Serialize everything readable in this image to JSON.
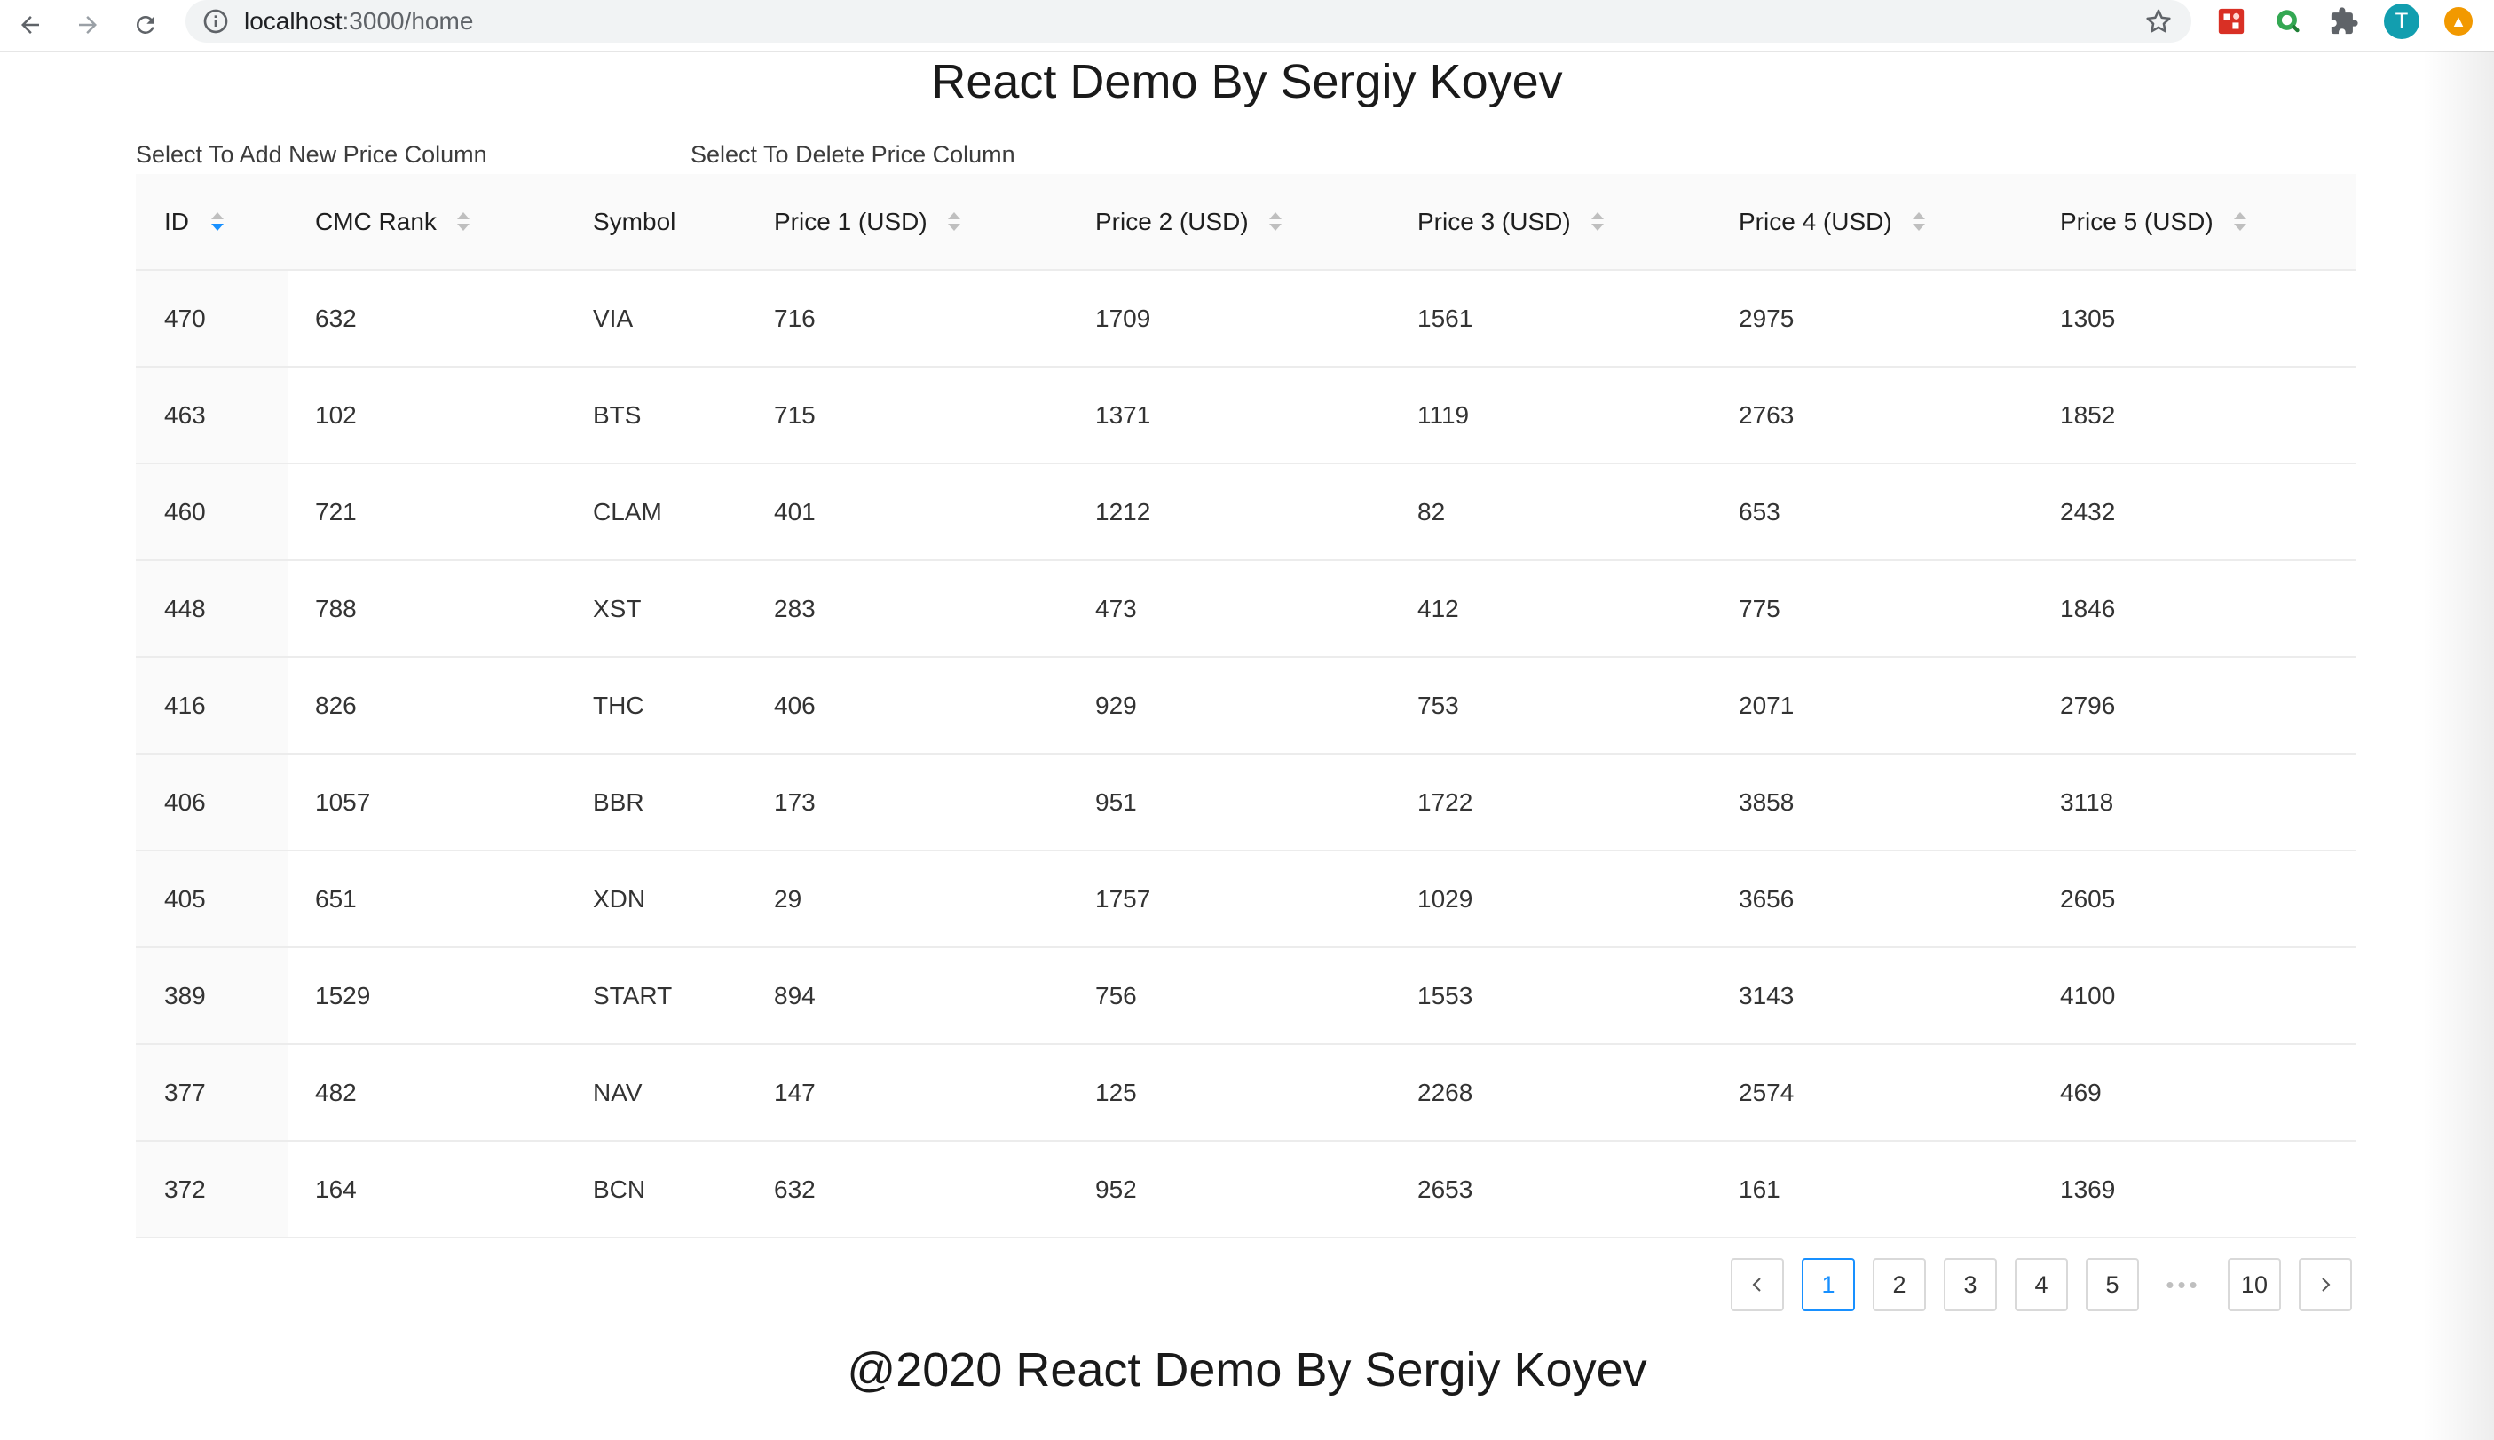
{
  "browser": {
    "url_host": "localhost",
    "url_path": ":3000/home",
    "profile_initial": "T"
  },
  "page": {
    "title": "React Demo By Sergiy Koyev",
    "add_column_label": "Select To Add New Price Column",
    "delete_column_label": "Select To Delete Price Column",
    "footer": "@2020 React Demo By Sergiy Koyev"
  },
  "table": {
    "columns": [
      "ID",
      "CMC Rank",
      "Symbol",
      "Price 1 (USD)",
      "Price 2 (USD)",
      "Price 3 (USD)",
      "Price 4 (USD)",
      "Price 5 (USD)"
    ],
    "sortable": [
      true,
      true,
      false,
      true,
      true,
      true,
      true,
      true
    ],
    "active_sort": {
      "column": "ID",
      "direction": "descending"
    },
    "rows": [
      [
        "470",
        "632",
        "VIA",
        "716",
        "1709",
        "1561",
        "2975",
        "1305"
      ],
      [
        "463",
        "102",
        "BTS",
        "715",
        "1371",
        "1119",
        "2763",
        "1852"
      ],
      [
        "460",
        "721",
        "CLAM",
        "401",
        "1212",
        "82",
        "653",
        "2432"
      ],
      [
        "448",
        "788",
        "XST",
        "283",
        "473",
        "412",
        "775",
        "1846"
      ],
      [
        "416",
        "826",
        "THC",
        "406",
        "929",
        "753",
        "2071",
        "2796"
      ],
      [
        "406",
        "1057",
        "BBR",
        "173",
        "951",
        "1722",
        "3858",
        "3118"
      ],
      [
        "405",
        "651",
        "XDN",
        "29",
        "1757",
        "1029",
        "3656",
        "2605"
      ],
      [
        "389",
        "1529",
        "START",
        "894",
        "756",
        "1553",
        "3143",
        "4100"
      ],
      [
        "377",
        "482",
        "NAV",
        "147",
        "125",
        "2268",
        "2574",
        "469"
      ],
      [
        "372",
        "164",
        "BCN",
        "632",
        "952",
        "2653",
        "161",
        "1369"
      ]
    ]
  },
  "pagination": {
    "pages": [
      "1",
      "2",
      "3",
      "4",
      "5",
      "10"
    ],
    "current": "1",
    "ellipsis": "•••"
  },
  "colors": {
    "accent": "#1890ff",
    "header_bg": "#fafafa",
    "border": "#ececec"
  }
}
